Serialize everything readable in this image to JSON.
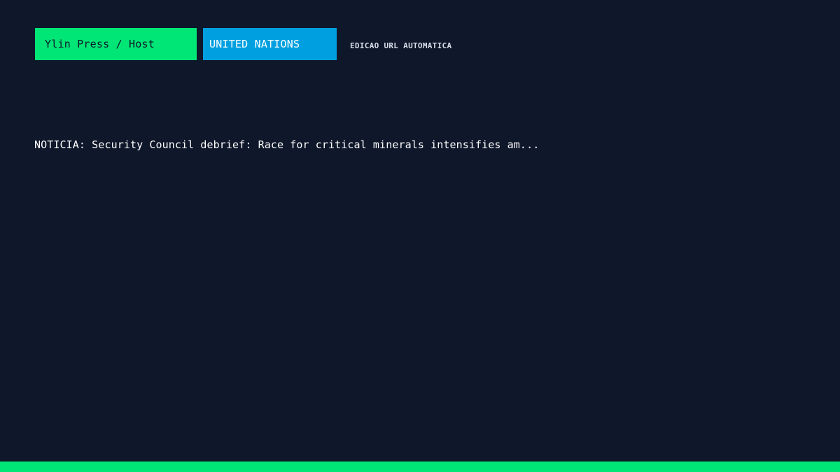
{
  "header": {
    "host_label": "Ylin Press / Host",
    "organization_label": "UNITED NATIONS",
    "edition_label": "EDICAO URL AUTOMATICA"
  },
  "main": {
    "headline": "NOTICIA: Security Council debrief: Race for critical minerals intensifies am..."
  },
  "colors": {
    "background": "#0f172a",
    "accent_green": "#00e676",
    "accent_blue": "#00a0e0",
    "text_light": "#ffffff"
  }
}
